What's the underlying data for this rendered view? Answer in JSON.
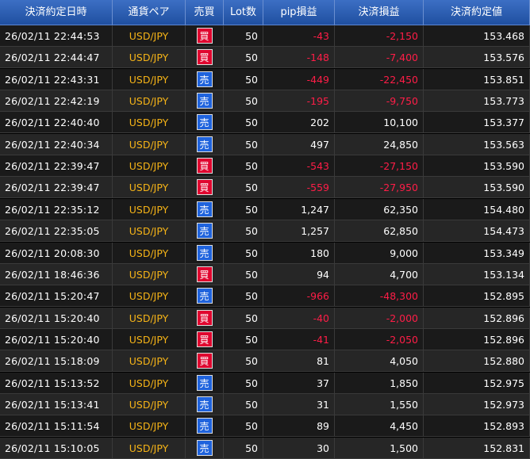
{
  "columns": [
    "決済約定日時",
    "通貨ペア",
    "売買",
    "Lot数",
    "pip損益",
    "決済損益",
    "決済約定値"
  ],
  "colors": {
    "buy": "#e0062f",
    "sell": "#1f63dd",
    "negative": "#ff1d47",
    "pair": "#f5b317"
  },
  "rows": [
    {
      "datetime": "26/02/11 22:44:53",
      "pair": "USD/JPY",
      "side": "買",
      "side_type": "buy",
      "lot": "50",
      "pip": "-43",
      "pnl": "-2,150",
      "price": "153.468",
      "neg": true
    },
    {
      "datetime": "26/02/11 22:44:47",
      "pair": "USD/JPY",
      "side": "買",
      "side_type": "buy",
      "lot": "50",
      "pip": "-148",
      "pnl": "-7,400",
      "price": "153.576",
      "neg": true
    },
    {
      "datetime": "26/02/11 22:43:31",
      "pair": "USD/JPY",
      "side": "売",
      "side_type": "sell",
      "lot": "50",
      "pip": "-449",
      "pnl": "-22,450",
      "price": "153.851",
      "neg": true
    },
    {
      "datetime": "26/02/11 22:42:19",
      "pair": "USD/JPY",
      "side": "売",
      "side_type": "sell",
      "lot": "50",
      "pip": "-195",
      "pnl": "-9,750",
      "price": "153.773",
      "neg": true
    },
    {
      "datetime": "26/02/11 22:40:40",
      "pair": "USD/JPY",
      "side": "売",
      "side_type": "sell",
      "lot": "50",
      "pip": "202",
      "pnl": "10,100",
      "price": "153.377",
      "neg": false
    },
    {
      "datetime": "26/02/11 22:40:34",
      "pair": "USD/JPY",
      "side": "売",
      "side_type": "sell",
      "lot": "50",
      "pip": "497",
      "pnl": "24,850",
      "price": "153.563",
      "neg": false
    },
    {
      "datetime": "26/02/11 22:39:47",
      "pair": "USD/JPY",
      "side": "買",
      "side_type": "buy",
      "lot": "50",
      "pip": "-543",
      "pnl": "-27,150",
      "price": "153.590",
      "neg": true
    },
    {
      "datetime": "26/02/11 22:39:47",
      "pair": "USD/JPY",
      "side": "買",
      "side_type": "buy",
      "lot": "50",
      "pip": "-559",
      "pnl": "-27,950",
      "price": "153.590",
      "neg": true
    },
    {
      "datetime": "26/02/11 22:35:12",
      "pair": "USD/JPY",
      "side": "売",
      "side_type": "sell",
      "lot": "50",
      "pip": "1,247",
      "pnl": "62,350",
      "price": "154.480",
      "neg": false
    },
    {
      "datetime": "26/02/11 22:35:05",
      "pair": "USD/JPY",
      "side": "売",
      "side_type": "sell",
      "lot": "50",
      "pip": "1,257",
      "pnl": "62,850",
      "price": "154.473",
      "neg": false
    },
    {
      "datetime": "26/02/11 20:08:30",
      "pair": "USD/JPY",
      "side": "売",
      "side_type": "sell",
      "lot": "50",
      "pip": "180",
      "pnl": "9,000",
      "price": "153.349",
      "neg": false
    },
    {
      "datetime": "26/02/11 18:46:36",
      "pair": "USD/JPY",
      "side": "買",
      "side_type": "buy",
      "lot": "50",
      "pip": "94",
      "pnl": "4,700",
      "price": "153.134",
      "neg": false
    },
    {
      "datetime": "26/02/11 15:20:47",
      "pair": "USD/JPY",
      "side": "売",
      "side_type": "sell",
      "lot": "50",
      "pip": "-966",
      "pnl": "-48,300",
      "price": "152.895",
      "neg": true
    },
    {
      "datetime": "26/02/11 15:20:40",
      "pair": "USD/JPY",
      "side": "買",
      "side_type": "buy",
      "lot": "50",
      "pip": "-40",
      "pnl": "-2,000",
      "price": "152.896",
      "neg": true
    },
    {
      "datetime": "26/02/11 15:20:40",
      "pair": "USD/JPY",
      "side": "買",
      "side_type": "buy",
      "lot": "50",
      "pip": "-41",
      "pnl": "-2,050",
      "price": "152.896",
      "neg": true
    },
    {
      "datetime": "26/02/11 15:18:09",
      "pair": "USD/JPY",
      "side": "買",
      "side_type": "buy",
      "lot": "50",
      "pip": "81",
      "pnl": "4,050",
      "price": "152.880",
      "neg": false
    },
    {
      "datetime": "26/02/11 15:13:52",
      "pair": "USD/JPY",
      "side": "売",
      "side_type": "sell",
      "lot": "50",
      "pip": "37",
      "pnl": "1,850",
      "price": "152.975",
      "neg": false
    },
    {
      "datetime": "26/02/11 15:13:41",
      "pair": "USD/JPY",
      "side": "売",
      "side_type": "sell",
      "lot": "50",
      "pip": "31",
      "pnl": "1,550",
      "price": "152.973",
      "neg": false
    },
    {
      "datetime": "26/02/11 15:11:54",
      "pair": "USD/JPY",
      "side": "売",
      "side_type": "sell",
      "lot": "50",
      "pip": "89",
      "pnl": "4,450",
      "price": "152.893",
      "neg": false
    },
    {
      "datetime": "26/02/11 15:10:05",
      "pair": "USD/JPY",
      "side": "売",
      "side_type": "sell",
      "lot": "50",
      "pip": "30",
      "pnl": "1,500",
      "price": "152.831",
      "neg": false
    }
  ]
}
